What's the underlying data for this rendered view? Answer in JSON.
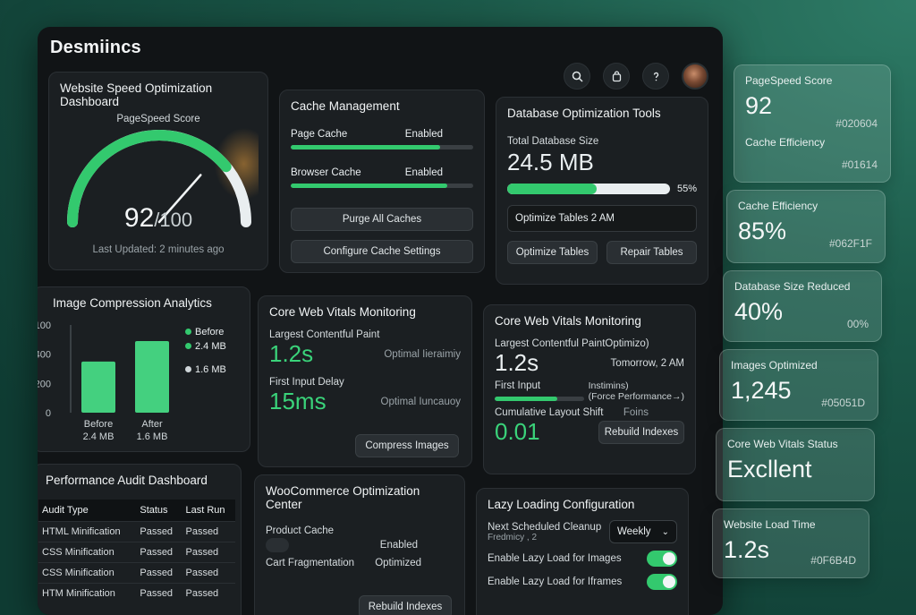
{
  "app": {
    "brand": "Desmiincs"
  },
  "speed_card": {
    "title": "Website Speed Optimization Dashboard",
    "subtitle": "PageSpeed Score",
    "score": "92",
    "score_max": "/100",
    "score_fraction": 0.92,
    "updated": "Last Updated: 2 minutes ago"
  },
  "cache_card": {
    "title": "Cache Management",
    "items": [
      {
        "label": "Page Cache",
        "status": "Enabled",
        "fill": 0.82
      },
      {
        "label": "Browser Cache",
        "status": "Enabled",
        "fill": 0.86
      }
    ],
    "purge_label": "Purge All Caches",
    "config_label": "Configure Cache Settings"
  },
  "db_card": {
    "title": "Database Optimization Tools",
    "size_label": "Total Database Size",
    "size_value": "24.5 MB",
    "percent": "55%",
    "fill": 0.55,
    "schedule_text": "Optimize Tables 2 AM",
    "optimize_label": "Optimize Tables",
    "repair_label": "Repair Tables"
  },
  "image_card": {
    "title": "Image Compression Analytics",
    "legend": [
      {
        "label": "Before",
        "color": "#33c96e"
      },
      {
        "label": "2.4 MB",
        "color": "#33c96e"
      },
      {
        "label": "1.6 MB",
        "color": "#cfd6d9"
      }
    ],
    "chart_data": {
      "type": "bar",
      "categories": [
        "Before",
        "After"
      ],
      "category_sublabels": [
        "2.4 MB",
        "1.6 MB"
      ],
      "values": [
        175,
        245
      ],
      "yticks": [
        "0",
        "200",
        "400",
        "100"
      ],
      "ylim": [
        0,
        300
      ],
      "color": "#44d07f"
    }
  },
  "cwv1": {
    "title": "Core Web Vitals Monitoring",
    "lcp_label": "Largest Contentful Paint",
    "lcp_value": "1.2s",
    "lcp_note": "Optimal Iieraimiy",
    "fid_label": "First Input Delay",
    "fid_value": "15ms",
    "fid_note": "Optimal Iuncauoy",
    "compress_label": "Compress Images"
  },
  "cwv2": {
    "title": "Core Web Vitals Monitoring",
    "lcp_label": "Largest Contentful PaintOptimizo)",
    "lcp_value": "1.2s",
    "lcp_note": "Tomorrow, 2 AM",
    "fi_label": "First Input",
    "fi_fill": 0.7,
    "fi_note1": "Instimins)",
    "fi_note2": "(Force Performance→)",
    "cls_label": "Cumulative Layout Shift",
    "cls_note": "Foins",
    "cls_value": "0.01",
    "rebuild_label": "Rebuild Indexes"
  },
  "audit_card": {
    "title": "Performance Audit Dashboard",
    "columns": [
      "Audit Type",
      "Status",
      "Last Run"
    ],
    "rows": [
      [
        "HTML Minification",
        "Passed",
        "Passed"
      ],
      [
        "CSS Minification",
        "Passed",
        "Passed"
      ],
      [
        "CSS Minification",
        "Passed",
        "Passed"
      ],
      [
        "HTM Minification",
        "Passed",
        "Passed"
      ]
    ]
  },
  "woo_card": {
    "title": "WooCommerce Optimization Center",
    "product_label": "Product Cache",
    "product_status": "Enabled",
    "cart_label": "Cart Fragmentation",
    "cart_status": "Optimized",
    "rebuild_label": "Rebuild Indexes"
  },
  "lazy_card": {
    "title": "Lazy Loading Configuration",
    "cleanup_label": "Next Scheduled Cleanup",
    "cleanup_sub": "Fredmicy , 2",
    "frequency": "Weekly",
    "img_label": "Enable Lazy Load for Images",
    "iframe_label": "Enable Lazy Load for Iframes"
  },
  "stats": [
    {
      "title": "PageSpeed Score",
      "value": "92",
      "hex": "#020604",
      "extra_label": "Cache Efficiency",
      "extra_hex": "#01614"
    },
    {
      "title": "Cache Efficiency",
      "value": "85%",
      "hex": "#062F1F"
    },
    {
      "title": "Database Size Reduced",
      "value": "40%",
      "hex": "00%"
    },
    {
      "title": "Images Optimized",
      "value": "1,245",
      "hex": "#05051D"
    },
    {
      "title": "Core Web Vitals Status",
      "value": "Excllent",
      "hex": ""
    },
    {
      "title": "Website Load Time",
      "value": "1.2s",
      "hex": "#0F6B4D"
    }
  ]
}
